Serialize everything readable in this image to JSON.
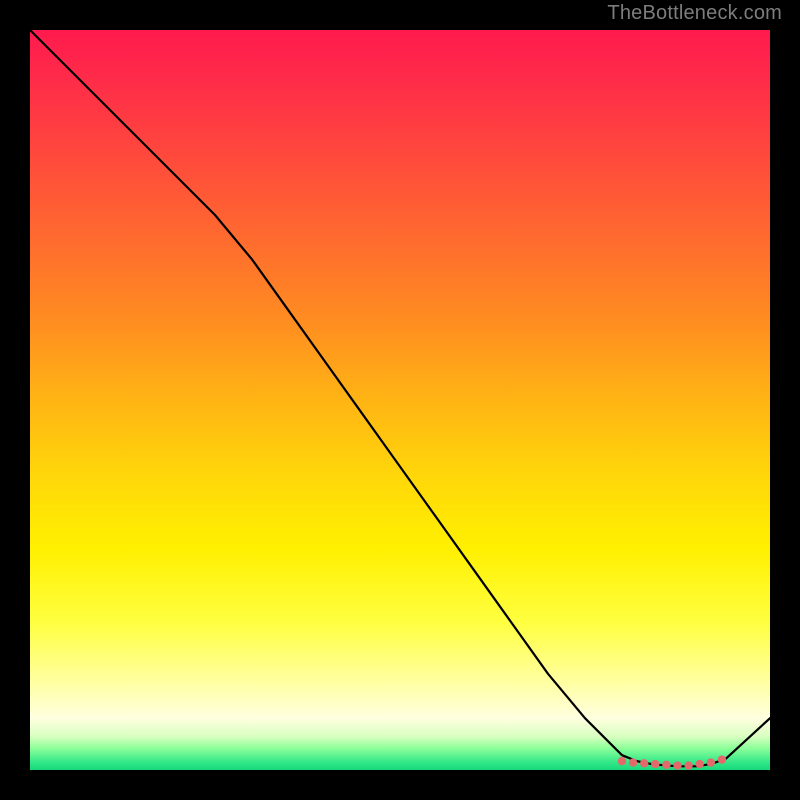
{
  "attribution": "TheBottleneck.com",
  "colors": {
    "background": "#000000",
    "curve": "#000000",
    "marker": "#e36a6a"
  },
  "chart_data": {
    "type": "line",
    "title": "",
    "xlabel": "",
    "ylabel": "",
    "xlim": [
      0,
      100
    ],
    "ylim": [
      0,
      100
    ],
    "grid": false,
    "legend": false,
    "series": [
      {
        "name": "bottleneck-curve",
        "x": [
          0,
          5,
          10,
          15,
          20,
          25,
          30,
          35,
          40,
          45,
          50,
          55,
          60,
          65,
          70,
          75,
          80,
          82,
          84,
          86,
          88,
          90,
          92,
          94,
          100
        ],
        "y": [
          100,
          95,
          90,
          85,
          80,
          75,
          69,
          62,
          55,
          48,
          41,
          34,
          27,
          20,
          13,
          7,
          2,
          1.2,
          0.8,
          0.6,
          0.5,
          0.5,
          0.8,
          1.5,
          7
        ]
      }
    ],
    "markers": {
      "name": "optimal-range",
      "x": [
        80,
        81.5,
        83,
        84.5,
        86,
        87.5,
        89,
        90.5,
        92,
        93.5
      ],
      "y": [
        1.2,
        1.0,
        0.9,
        0.8,
        0.7,
        0.6,
        0.6,
        0.8,
        1.0,
        1.4
      ]
    }
  }
}
